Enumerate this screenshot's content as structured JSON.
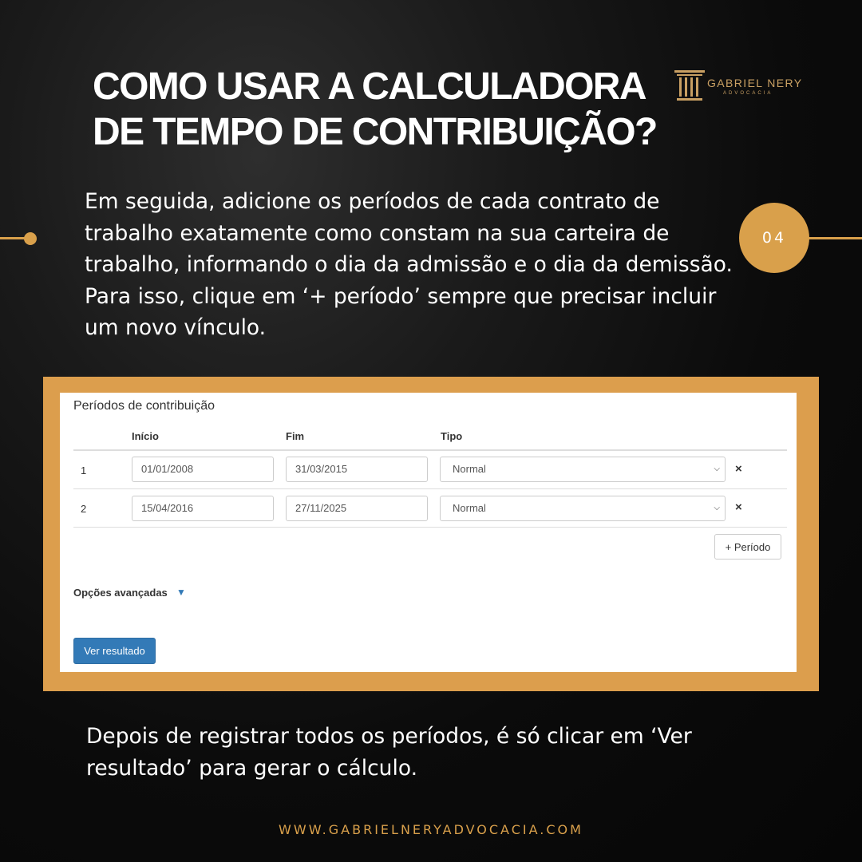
{
  "header": {
    "title_line1": "COMO USAR A CALCULADORA",
    "title_line2": "DE TEMPO DE CONTRIBUIÇÃO?"
  },
  "logo": {
    "name": "GABRIEL NERY",
    "subtitle": "ADVOCACIA",
    "icon": "pillars-icon"
  },
  "step_number": "04",
  "intro_text": "Em seguida, adicione os períodos de cada contrato de trabalho exatamente como constam na sua carteira de trabalho, informando o dia da admissão e o dia da demissão. Para isso, clique em ‘+ período’ sempre que precisar incluir um novo vínculo.",
  "form": {
    "title": "Períodos de contribuição",
    "columns": [
      "Início",
      "Fim",
      "Tipo"
    ],
    "rows": [
      {
        "num": "1",
        "inicio": "01/01/2008",
        "fim": "31/03/2015",
        "tipo": "Normal"
      },
      {
        "num": "2",
        "inicio": "15/04/2016",
        "fim": "27/11/2025",
        "tipo": "Normal"
      }
    ],
    "delete_icon": "×",
    "select_arrow": "⌄",
    "add_button": "+ Período",
    "advanced_label": "Opções avançadas",
    "advanced_arrow": "▼",
    "result_button": "Ver resultado"
  },
  "outro_text": "Depois de registrar todos os períodos, é só clicar em ‘Ver resultado’ para gerar o cálculo.",
  "footer": "WWW.GABRIELNERYADVOCACIA.COM",
  "colors": {
    "accent": "#d9a04b",
    "background": "#0b0b0b",
    "primary_button": "#337ab7"
  }
}
